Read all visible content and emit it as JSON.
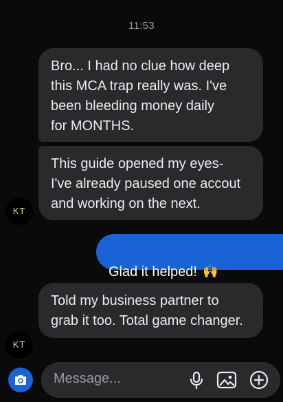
{
  "status": {
    "timestamp": "11:53"
  },
  "contact": {
    "avatar_initials": "KT"
  },
  "messages": [
    {
      "direction": "incoming",
      "text": "Bro... I had no clue how deep\nthis MCA trap really was. I've\nbeen bleeding money daily\nfor MONTHS."
    },
    {
      "direction": "incoming",
      "text": "This guide opened my eyes-\nI've already paused one accout\nand working on the next."
    },
    {
      "direction": "outgoing",
      "text": "Glad it helped!",
      "emoji": "🙌"
    },
    {
      "direction": "incoming",
      "text": "Told my business partner to\ngrab it too. Total game changer."
    }
  ],
  "composer": {
    "placeholder": "Message..."
  },
  "colors": {
    "background": "#0a0a0a",
    "incoming_bubble": "#2a2a2d",
    "outgoing_bubble": "#1a63d6"
  },
  "icons": {
    "camera": "camera-icon",
    "mic": "microphone-icon",
    "gallery": "image-gallery-icon",
    "plus": "add-icon"
  }
}
